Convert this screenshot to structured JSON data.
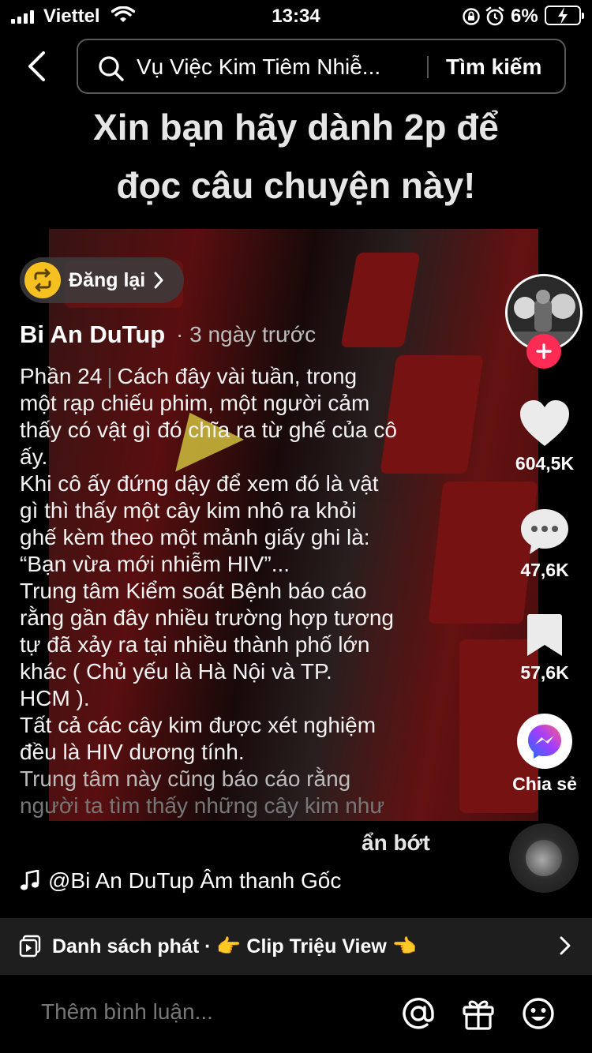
{
  "status_bar": {
    "carrier": "Viettel",
    "time": "13:34",
    "battery_pct": "6%"
  },
  "search": {
    "query": "Vụ Việc Kim Tiêm Nhiễ...",
    "button_label": "Tìm kiếm"
  },
  "video": {
    "headline_line1": "Xin bạn hãy dành 2p để",
    "headline_line2": "đọc câu chuyện này!"
  },
  "repost": {
    "label": "Đăng lại"
  },
  "post": {
    "author": "Bi An DuTup",
    "posted": "· 3 ngày trước",
    "part_label": "Phần 24",
    "caption_lines": [
      "Cách đây vài tuần, trong",
      "một rạp chiếu phim, một người cảm",
      "thấy có vật gì đó chĩa ra từ ghế của cô",
      "ấy.",
      "Khi cô ấy đứng dậy để xem đó là vật",
      "gì thì thấy một cây kim nhô ra khỏi",
      "ghế kèm theo một mảnh giấy ghi là:",
      "“Bạn vừa mới nhiễm HIV”...",
      "Trung tâm Kiểm soát Bệnh báo cáo",
      "rằng gần đây nhiều trường hợp tương",
      "tự đã xảy ra tại nhiều thành phố lớn",
      "khác ( Chủ yếu là Hà Nội và TP.",
      "HCM ).",
      "Tất cả các cây kim được xét nghiệm",
      "đều là HIV dương tính.",
      "Trung tâm này cũng báo cáo rằng",
      "người ta tìm thấy những cây kim như"
    ],
    "show_less": "ẩn bớt",
    "sound": "@Bi An DuTup Âm thanh Gốc"
  },
  "rail": {
    "likes": "604,5K",
    "comments": "47,6K",
    "saves": "57,6K",
    "share_label": "Chia sẻ"
  },
  "playlist": {
    "text": "Danh sách phát · 👉 Clip Triệu View 👈"
  },
  "comment_bar": {
    "placeholder": "Thêm bình luận..."
  },
  "colors": {
    "accent": "#fe2c55",
    "repost_yellow": "#f5c020"
  }
}
